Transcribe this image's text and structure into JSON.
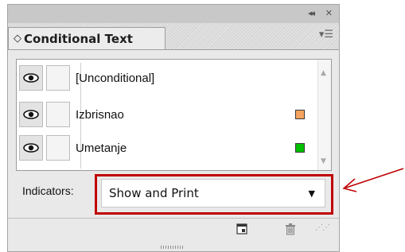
{
  "panel": {
    "title": "Conditional Text",
    "tab_icon": "◇",
    "topbar": {
      "collapse_glyph": "◂◂",
      "close_glyph": "✕"
    },
    "menu_icon": "▾☰"
  },
  "conditions": [
    {
      "label": "[Unconditional]",
      "visible": true,
      "color": null
    },
    {
      "label": "Izbrisnao",
      "visible": true,
      "color": "#f4a460"
    },
    {
      "label": "Umetanje",
      "visible": true,
      "color": "#00c000"
    }
  ],
  "indicators": {
    "label": "Indicators:",
    "selected": "Show and Print"
  },
  "colors": {
    "highlight": "#c00000",
    "arrow": "#c00000"
  },
  "icons": {
    "eye": "eye-icon",
    "dropdown": "chevron-down-icon",
    "new_condition": "new-condition-icon",
    "trash": "trash-icon"
  }
}
